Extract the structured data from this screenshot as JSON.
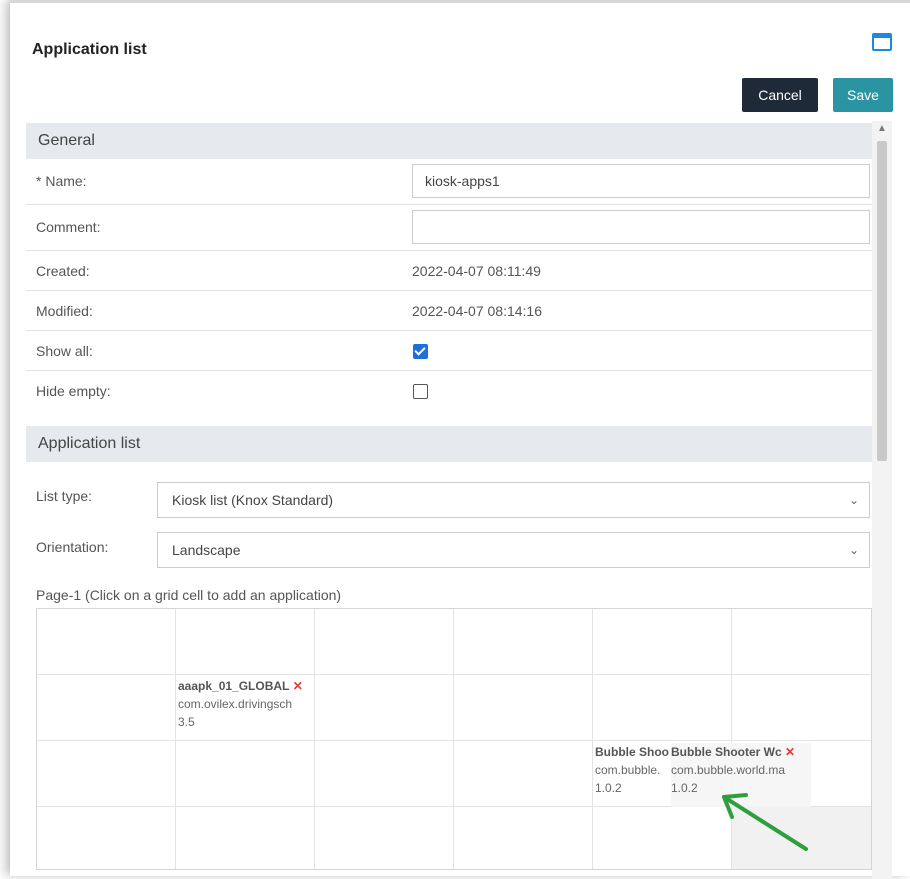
{
  "window": {
    "title": "Application list"
  },
  "toolbar": {
    "cancel_label": "Cancel",
    "save_label": "Save"
  },
  "general": {
    "section_title": "General",
    "name_label": "* Name:",
    "name_value": "kiosk-apps1",
    "comment_label": "Comment:",
    "comment_value": "",
    "created_label": "Created:",
    "created_value": "2022-04-07 08:11:49",
    "modified_label": "Modified:",
    "modified_value": "2022-04-07 08:14:16",
    "show_all_label": "Show all:",
    "show_all_checked": true,
    "hide_empty_label": "Hide empty:",
    "hide_empty_checked": false
  },
  "application_list": {
    "section_title": "Application list",
    "list_type_label": "List type:",
    "list_type_value": "Kiosk list (Knox Standard)",
    "orientation_label": "Orientation:",
    "orientation_value": "Landscape",
    "grid_caption": "Page-1 (Click on a grid cell to add an application)",
    "apps": [
      {
        "name": "aaapk_01_GLOBAL",
        "package": "com.ovilex.drivingsch",
        "version": "3.5"
      },
      {
        "name": "Bubble Shoo",
        "package": "com.bubble.",
        "version": "1.0.2"
      },
      {
        "name": "Bubble Shooter Wc",
        "package": "com.bubble.world.ma",
        "version": "1.0.2"
      }
    ],
    "remove_glyph": "✕"
  },
  "colors": {
    "accent": "#2a94a3",
    "dark_button": "#1f2a38",
    "checkbox": "#1e6fd9",
    "arrow": "#2e9e3e",
    "remove": "#e53935"
  }
}
